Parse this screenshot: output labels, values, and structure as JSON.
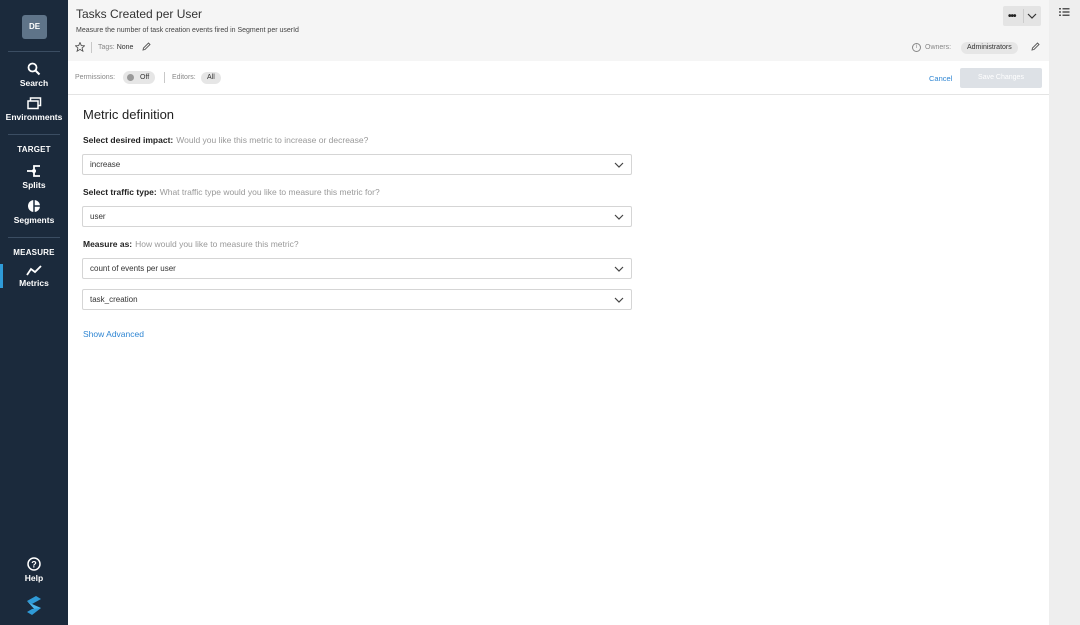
{
  "sidebar": {
    "avatar": "DE",
    "items": [
      {
        "label": "Search",
        "icon": "search-icon"
      },
      {
        "label": "Environments",
        "icon": "environments-icon"
      },
      {
        "label": "Splits",
        "icon": "splits-icon"
      },
      {
        "label": "Segments",
        "icon": "segments-icon"
      },
      {
        "label": "Metrics",
        "icon": "metrics-icon"
      },
      {
        "label": "Help",
        "icon": "help-icon"
      }
    ],
    "sections": {
      "target": "TARGET",
      "measure": "MEASURE"
    },
    "active_color": "#2f9bd8",
    "logo": "split-logo"
  },
  "header": {
    "title": "Tasks Created per User",
    "subtitle": "Measure the number of task creation events fired in Segment per userId",
    "tags_label": "Tags:",
    "tags_value": "None",
    "owners_label": "Owners:",
    "owners_value": "Administrators"
  },
  "permissions": {
    "label": "Permissions:",
    "toggle": "Off",
    "editors_label": "Editors:",
    "editors_value": "All",
    "cancel": "Cancel",
    "save": "Save Changes"
  },
  "form": {
    "title": "Metric definition",
    "impact": {
      "label": "Select desired impact:",
      "hint": "Would you like this metric to increase or decrease?",
      "value": "increase"
    },
    "traffic": {
      "label": "Select traffic type:",
      "hint": "What traffic type would you like to measure this metric for?",
      "value": "user"
    },
    "measure": {
      "label": "Measure as:",
      "hint": "How would you like to measure this metric?",
      "value": "count of events per user",
      "event": "task_creation"
    },
    "show_advanced": "Show Advanced"
  },
  "colors": {
    "sidebar_bg": "#1b2a3c",
    "link": "#2f86d3",
    "header_bg": "#f5f5f5"
  }
}
